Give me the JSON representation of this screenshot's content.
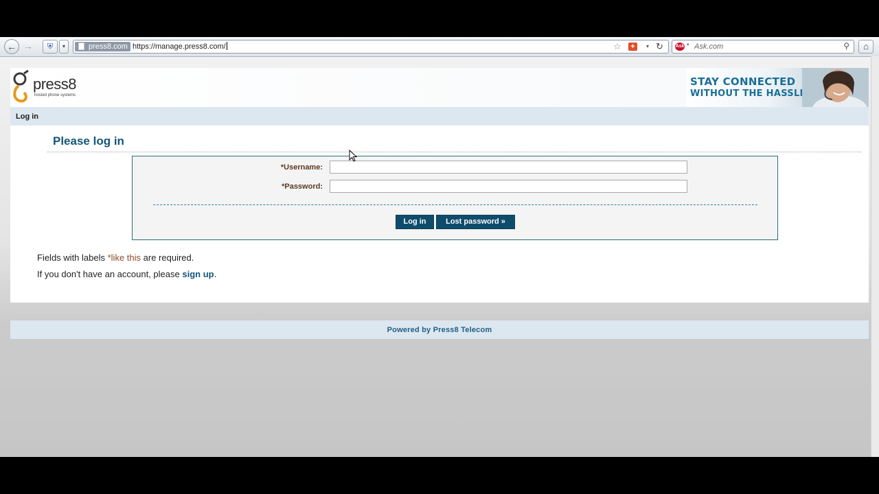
{
  "browser": {
    "back_label": "",
    "url": "https://manage.press8.com/",
    "site_identity": "press8.com",
    "search_placeholder": "Ask.com",
    "search_engine_icon": "ask-icon"
  },
  "header": {
    "logo_text": "press8",
    "logo_tagline": "hosted phone systems",
    "banner_line1": "STAY CONNECTED",
    "banner_line2": "WITHOUT THE HASSLE"
  },
  "breadcrumb": {
    "current": "Log in"
  },
  "main": {
    "title": "Please log in",
    "username_label": "*Username:",
    "password_label": "*Password:",
    "username_value": "",
    "password_value": "",
    "login_button": "Log in",
    "lost_password_button": "Lost password »",
    "required_prefix": "Fields with labels ",
    "required_sample": "*like this",
    "required_suffix": " are required.",
    "signup_prefix": "If you don't have an account, please ",
    "signup_link": "sign up",
    "signup_suffix": "."
  },
  "footer": {
    "text": "Powered by Press8 Telecom"
  },
  "colors": {
    "accent": "#13567a",
    "button": "#0f4c6c",
    "nav_bar": "#dde7f0",
    "label": "#5a3a22"
  }
}
